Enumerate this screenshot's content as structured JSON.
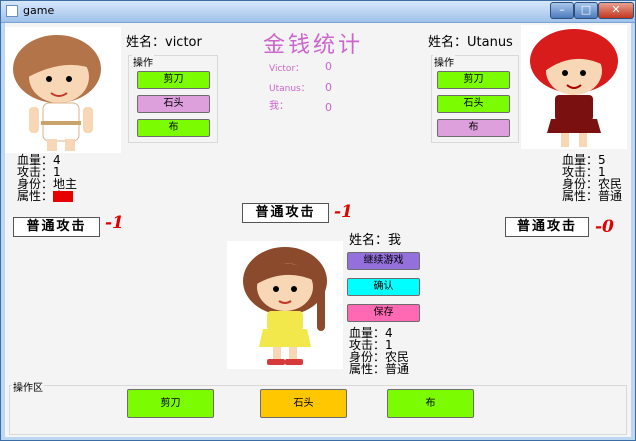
{
  "window": {
    "title": "game"
  },
  "header": {
    "title": "金钱统计"
  },
  "money": {
    "victor_label": "Victor：",
    "victor_value": "0",
    "utanus_label": "Utanus：",
    "utanus_value": "0",
    "me_label": "我：",
    "me_value": "0"
  },
  "player_left": {
    "name_label": "姓名：victor",
    "ops_title": "操作",
    "buttons": [
      "剪刀",
      "石头",
      "布"
    ],
    "hp": "血量：4",
    "atk": "攻击：1",
    "role": "身份：地主",
    "attr_label": "属性：",
    "attr_value": "火",
    "attack_label": "普通攻击",
    "delta": "-1"
  },
  "player_right": {
    "name_label": "姓名：Utanus",
    "ops_title": "操作",
    "buttons": [
      "剪刀",
      "石头",
      "布"
    ],
    "hp": "血量：5",
    "atk": "攻击：1",
    "role": "身份：农民",
    "attr": "属性：普通",
    "attack_label": "普通攻击",
    "delta": "-0"
  },
  "center": {
    "attack_label": "普通攻击",
    "delta": "-1"
  },
  "player_me": {
    "name_label": "姓名：我",
    "continue_label": "继续游戏",
    "confirm_label": "确认",
    "save_label": "保存",
    "hp": "血量：4",
    "atk": "攻击：1",
    "role": "身份：农民",
    "attr": "属性：普通"
  },
  "op_area": {
    "title": "操作区",
    "buttons": [
      "剪刀",
      "石头",
      "布"
    ]
  },
  "colors": {
    "green": "#7cfc00",
    "orchid": "#dda0dd",
    "purple": "#9370db",
    "cyan": "#00ffff",
    "pink": "#ff69b4",
    "gold": "#ffc700",
    "red": "#e60000"
  }
}
